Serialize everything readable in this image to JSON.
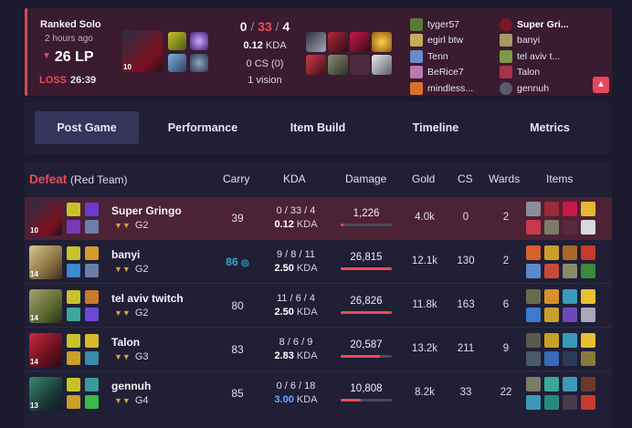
{
  "summary": {
    "queue": "Ranked Solo",
    "time_ago": "2 hours ago",
    "lp": "26 LP",
    "result": "LOSS",
    "duration": "26:39",
    "champion_level": "10",
    "kills": "0",
    "deaths": "33",
    "assists": "4",
    "kda_ratio": "0.12",
    "kda_suffix": "KDA",
    "cs": "0 CS (0)",
    "vision": "1 vision",
    "blue_team": [
      "tyger57",
      "egirl btw",
      "Tenn",
      "BeRice7",
      "mindless..."
    ],
    "red_team": [
      "Super Gri...",
      "banyi",
      "tel aviv t...",
      "Talon",
      "gennuh"
    ],
    "expand_icon": "chevron-up-icon"
  },
  "tabs": [
    "Post Game",
    "Performance",
    "Item Build",
    "Timeline",
    "Metrics"
  ],
  "table": {
    "result": "Defeat",
    "team": "(Red Team)",
    "headers": {
      "carry": "Carry",
      "kda": "KDA",
      "damage": "Damage",
      "gold": "Gold",
      "cs": "CS",
      "wards": "Wards",
      "items": "Items"
    },
    "rows": [
      {
        "name": "Super Gringo",
        "rank": "G2",
        "level": "10",
        "carry": "39",
        "kda": "0 / 33 / 4",
        "ratio": "0.12",
        "ratio_suffix": "KDA",
        "damage": "1,226",
        "damage_share": 0.046,
        "gold": "4.0k",
        "cs": "0",
        "wards": "2"
      },
      {
        "name": "banyi",
        "rank": "G2",
        "level": "14",
        "carry": "86",
        "kda": "9 / 8 / 11",
        "ratio": "2.50",
        "ratio_suffix": "KDA",
        "damage": "26,815",
        "damage_share": 1.0,
        "gold": "12.1k",
        "cs": "130",
        "wards": "2"
      },
      {
        "name": "tel aviv twitch",
        "rank": "G2",
        "level": "14",
        "carry": "80",
        "kda": "11 / 6 / 4",
        "ratio": "2.50",
        "ratio_suffix": "KDA",
        "damage": "26,826",
        "damage_share": 1.0,
        "gold": "11.8k",
        "cs": "163",
        "wards": "6"
      },
      {
        "name": "Talon",
        "rank": "G3",
        "level": "14",
        "carry": "83",
        "kda": "8 / 6 / 9",
        "ratio": "2.83",
        "ratio_suffix": "KDA",
        "damage": "20,587",
        "damage_share": 0.77,
        "gold": "13.2k",
        "cs": "211",
        "wards": "9"
      },
      {
        "name": "gennuh",
        "rank": "G4",
        "level": "13",
        "carry": "85",
        "kda": "0 / 6 / 18",
        "ratio": "3.00",
        "ratio_suffix": "KDA",
        "damage": "10,808",
        "damage_share": 0.4,
        "gold": "8.2k",
        "cs": "33",
        "wards": "22"
      }
    ]
  },
  "colors": {
    "accent": "#ef4a59",
    "mvp": "#3aa7c7",
    "ratio_blue": "#6aa8ff"
  }
}
